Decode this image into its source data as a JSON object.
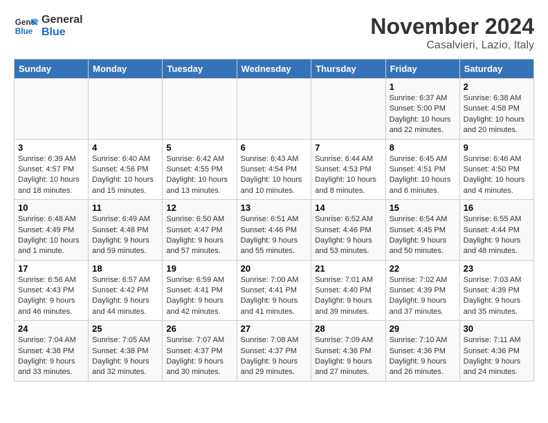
{
  "header": {
    "logo_line1": "General",
    "logo_line2": "Blue",
    "month": "November 2024",
    "location": "Casalvieri, Lazio, Italy"
  },
  "weekdays": [
    "Sunday",
    "Monday",
    "Tuesday",
    "Wednesday",
    "Thursday",
    "Friday",
    "Saturday"
  ],
  "weeks": [
    [
      {
        "day": "",
        "info": ""
      },
      {
        "day": "",
        "info": ""
      },
      {
        "day": "",
        "info": ""
      },
      {
        "day": "",
        "info": ""
      },
      {
        "day": "",
        "info": ""
      },
      {
        "day": "1",
        "info": "Sunrise: 6:37 AM\nSunset: 5:00 PM\nDaylight: 10 hours and 22 minutes."
      },
      {
        "day": "2",
        "info": "Sunrise: 6:38 AM\nSunset: 4:58 PM\nDaylight: 10 hours and 20 minutes."
      }
    ],
    [
      {
        "day": "3",
        "info": "Sunrise: 6:39 AM\nSunset: 4:57 PM\nDaylight: 10 hours and 18 minutes."
      },
      {
        "day": "4",
        "info": "Sunrise: 6:40 AM\nSunset: 4:56 PM\nDaylight: 10 hours and 15 minutes."
      },
      {
        "day": "5",
        "info": "Sunrise: 6:42 AM\nSunset: 4:55 PM\nDaylight: 10 hours and 13 minutes."
      },
      {
        "day": "6",
        "info": "Sunrise: 6:43 AM\nSunset: 4:54 PM\nDaylight: 10 hours and 10 minutes."
      },
      {
        "day": "7",
        "info": "Sunrise: 6:44 AM\nSunset: 4:53 PM\nDaylight: 10 hours and 8 minutes."
      },
      {
        "day": "8",
        "info": "Sunrise: 6:45 AM\nSunset: 4:51 PM\nDaylight: 10 hours and 6 minutes."
      },
      {
        "day": "9",
        "info": "Sunrise: 6:46 AM\nSunset: 4:50 PM\nDaylight: 10 hours and 4 minutes."
      }
    ],
    [
      {
        "day": "10",
        "info": "Sunrise: 6:48 AM\nSunset: 4:49 PM\nDaylight: 10 hours and 1 minute."
      },
      {
        "day": "11",
        "info": "Sunrise: 6:49 AM\nSunset: 4:48 PM\nDaylight: 9 hours and 59 minutes."
      },
      {
        "day": "12",
        "info": "Sunrise: 6:50 AM\nSunset: 4:47 PM\nDaylight: 9 hours and 57 minutes."
      },
      {
        "day": "13",
        "info": "Sunrise: 6:51 AM\nSunset: 4:46 PM\nDaylight: 9 hours and 55 minutes."
      },
      {
        "day": "14",
        "info": "Sunrise: 6:52 AM\nSunset: 4:46 PM\nDaylight: 9 hours and 53 minutes."
      },
      {
        "day": "15",
        "info": "Sunrise: 6:54 AM\nSunset: 4:45 PM\nDaylight: 9 hours and 50 minutes."
      },
      {
        "day": "16",
        "info": "Sunrise: 6:55 AM\nSunset: 4:44 PM\nDaylight: 9 hours and 48 minutes."
      }
    ],
    [
      {
        "day": "17",
        "info": "Sunrise: 6:56 AM\nSunset: 4:43 PM\nDaylight: 9 hours and 46 minutes."
      },
      {
        "day": "18",
        "info": "Sunrise: 6:57 AM\nSunset: 4:42 PM\nDaylight: 9 hours and 44 minutes."
      },
      {
        "day": "19",
        "info": "Sunrise: 6:59 AM\nSunset: 4:41 PM\nDaylight: 9 hours and 42 minutes."
      },
      {
        "day": "20",
        "info": "Sunrise: 7:00 AM\nSunset: 4:41 PM\nDaylight: 9 hours and 41 minutes."
      },
      {
        "day": "21",
        "info": "Sunrise: 7:01 AM\nSunset: 4:40 PM\nDaylight: 9 hours and 39 minutes."
      },
      {
        "day": "22",
        "info": "Sunrise: 7:02 AM\nSunset: 4:39 PM\nDaylight: 9 hours and 37 minutes."
      },
      {
        "day": "23",
        "info": "Sunrise: 7:03 AM\nSunset: 4:39 PM\nDaylight: 9 hours and 35 minutes."
      }
    ],
    [
      {
        "day": "24",
        "info": "Sunrise: 7:04 AM\nSunset: 4:38 PM\nDaylight: 9 hours and 33 minutes."
      },
      {
        "day": "25",
        "info": "Sunrise: 7:05 AM\nSunset: 4:38 PM\nDaylight: 9 hours and 32 minutes."
      },
      {
        "day": "26",
        "info": "Sunrise: 7:07 AM\nSunset: 4:37 PM\nDaylight: 9 hours and 30 minutes."
      },
      {
        "day": "27",
        "info": "Sunrise: 7:08 AM\nSunset: 4:37 PM\nDaylight: 9 hours and 29 minutes."
      },
      {
        "day": "28",
        "info": "Sunrise: 7:09 AM\nSunset: 4:36 PM\nDaylight: 9 hours and 27 minutes."
      },
      {
        "day": "29",
        "info": "Sunrise: 7:10 AM\nSunset: 4:36 PM\nDaylight: 9 hours and 26 minutes."
      },
      {
        "day": "30",
        "info": "Sunrise: 7:11 AM\nSunset: 4:36 PM\nDaylight: 9 hours and 24 minutes."
      }
    ]
  ]
}
